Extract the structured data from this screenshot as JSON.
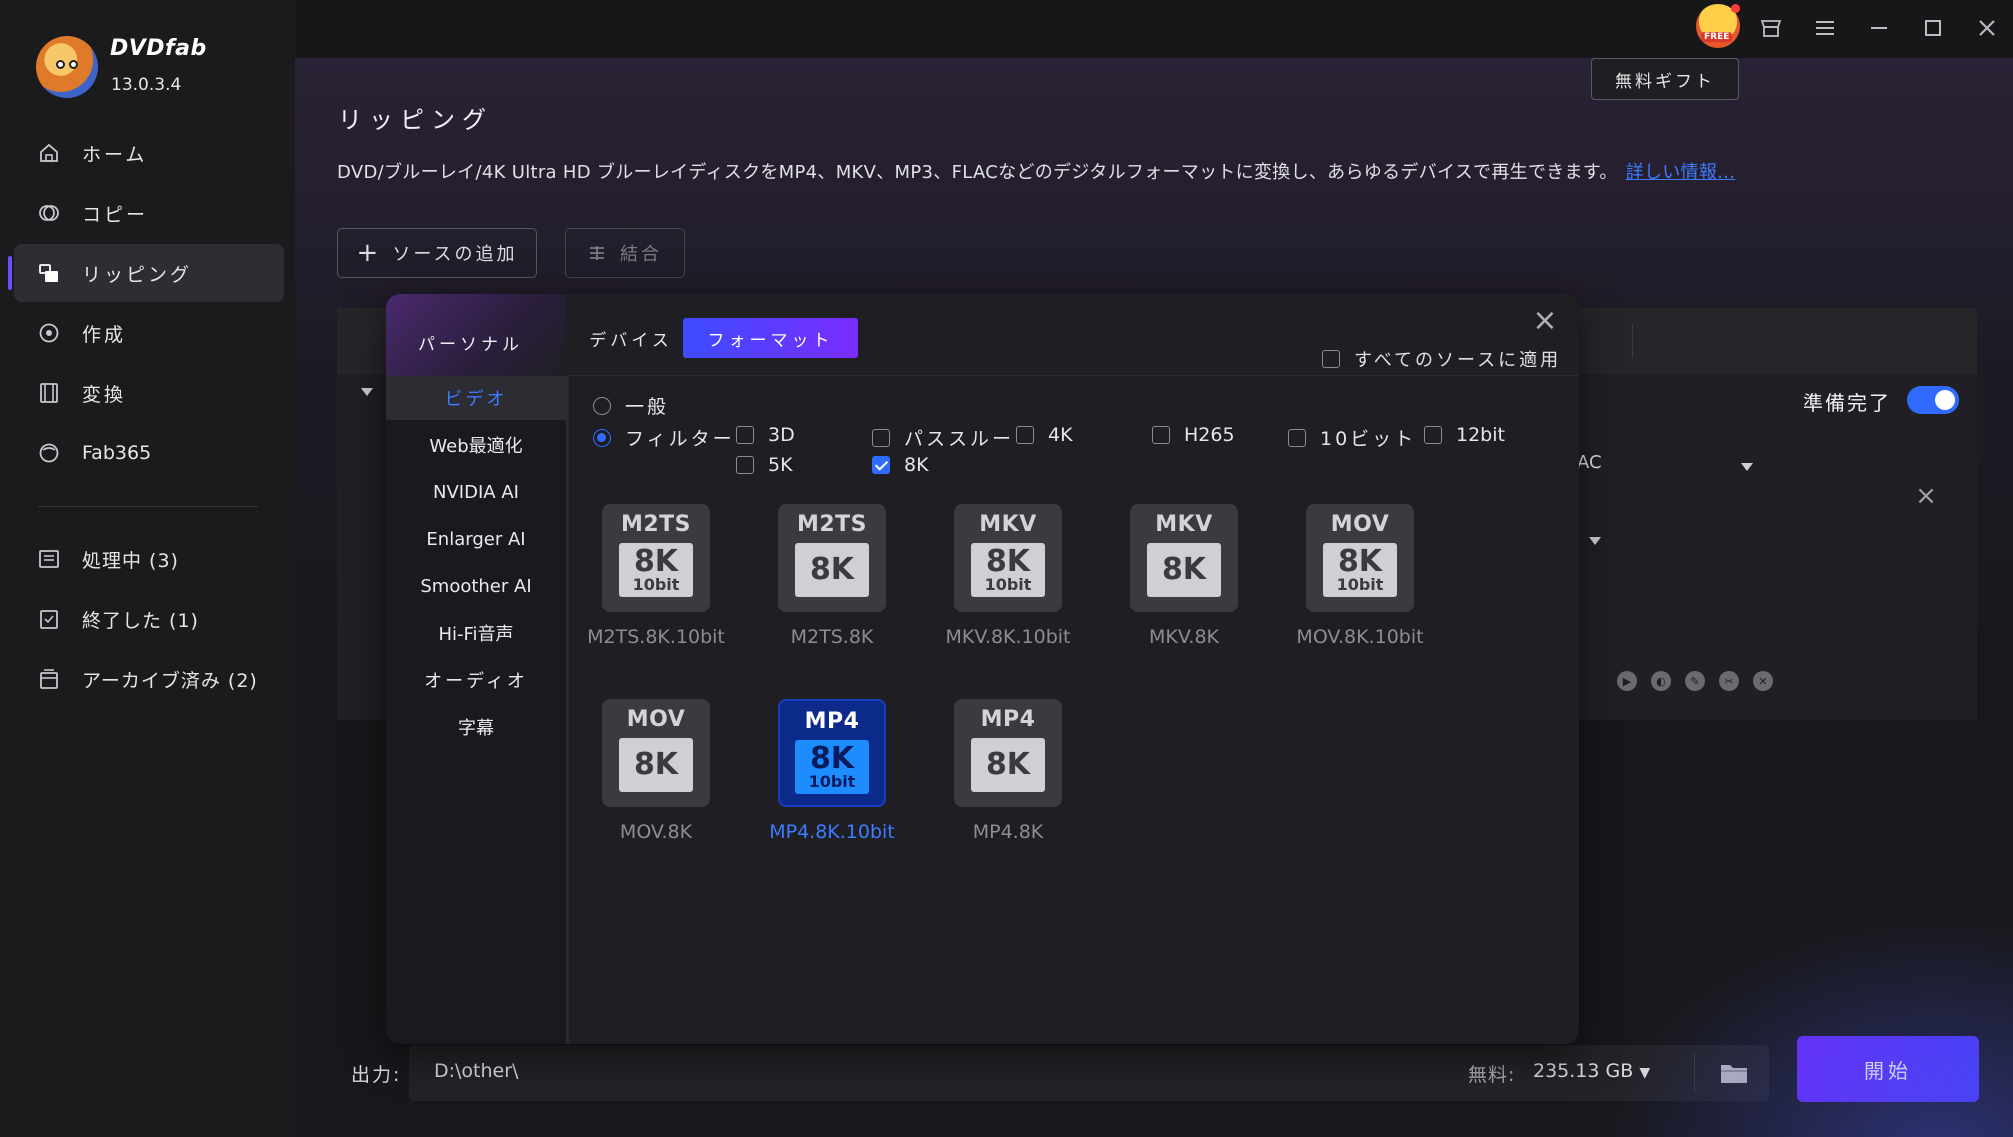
{
  "app": {
    "name": "DVDfab",
    "version": "13.0.3.4"
  },
  "sidebar": {
    "items": [
      {
        "label": "ホーム",
        "icon": "home-icon"
      },
      {
        "label": "コピー",
        "icon": "copy-icon"
      },
      {
        "label": "リッピング",
        "icon": "ripper-icon",
        "active": true
      },
      {
        "label": "作成",
        "icon": "creator-icon"
      },
      {
        "label": "変換",
        "icon": "converter-icon"
      },
      {
        "label": "Fab365",
        "icon": "fab365-icon"
      }
    ],
    "queue": [
      {
        "label": "処理中 (3)",
        "icon": "processing-icon"
      },
      {
        "label": "終了した (1)",
        "icon": "finished-icon"
      },
      {
        "label": "アーカイブ済み (2)",
        "icon": "archive-icon"
      }
    ]
  },
  "topbar": {
    "free_badge": "FREE",
    "gift_button": "無料ギフト"
  },
  "page": {
    "title": "リッピング",
    "description": "DVD/ブルーレイ/4K Ultra HD ブルーレイディスクをMP4、MKV、MP3、FLACなどのデジタルフォーマットに変換し、あらゆるデバイスで再生できます。",
    "more_link": "詳しい情報...",
    "add_source": "ソースの追加",
    "merge": "結合",
    "ready_label": "準備完了",
    "ready_on": true,
    "audio_partial": "AC"
  },
  "output": {
    "label": "出力:",
    "path": "D:\\other\\",
    "free_label": "無料:",
    "free_space": "235.13 GB",
    "start_button": "開始"
  },
  "modal": {
    "left_header": "パーソナル",
    "tabs": [
      {
        "label": "デバイス",
        "active": false
      },
      {
        "label": "フォーマット",
        "active": true
      }
    ],
    "apply_all": "すべてのソースに適用",
    "categories": [
      {
        "label": "ビデオ",
        "active": true
      },
      {
        "label": "Web最適化"
      },
      {
        "label": "NVIDIA AI"
      },
      {
        "label": "Enlarger AI"
      },
      {
        "label": "Smoother AI"
      },
      {
        "label": "Hi-Fi音声"
      },
      {
        "label": "オーディオ"
      },
      {
        "label": "字幕"
      }
    ],
    "mode": {
      "general": "一般",
      "filter": "フィルター",
      "selected": "filter"
    },
    "filters": [
      {
        "label": "3D",
        "checked": false
      },
      {
        "label": "パススルー",
        "checked": false
      },
      {
        "label": "4K",
        "checked": false
      },
      {
        "label": "H265",
        "checked": false
      },
      {
        "label": "10ビット",
        "checked": false
      },
      {
        "label": "12bit",
        "checked": false
      },
      {
        "label": "5K",
        "checked": false
      },
      {
        "label": "8K",
        "checked": true
      }
    ],
    "formats": [
      {
        "container": "M2TS",
        "res": "8K",
        "bit": "10bit",
        "label": "M2TS.8K.10bit"
      },
      {
        "container": "M2TS",
        "res": "8K",
        "bit": "",
        "label": "M2TS.8K"
      },
      {
        "container": "MKV",
        "res": "8K",
        "bit": "10bit",
        "label": "MKV.8K.10bit"
      },
      {
        "container": "MKV",
        "res": "8K",
        "bit": "",
        "label": "MKV.8K"
      },
      {
        "container": "MOV",
        "res": "8K",
        "bit": "10bit",
        "label": "MOV.8K.10bit"
      },
      {
        "container": "MOV",
        "res": "8K",
        "bit": "",
        "label": "MOV.8K"
      },
      {
        "container": "MP4",
        "res": "8K",
        "bit": "10bit",
        "label": "MP4.8K.10bit",
        "selected": true
      },
      {
        "container": "MP4",
        "res": "8K",
        "bit": "",
        "label": "MP4.8K"
      }
    ]
  },
  "colors": {
    "accent": "#2f6bff",
    "start_gradient": "#6a2cff",
    "link": "#3d7bff"
  }
}
